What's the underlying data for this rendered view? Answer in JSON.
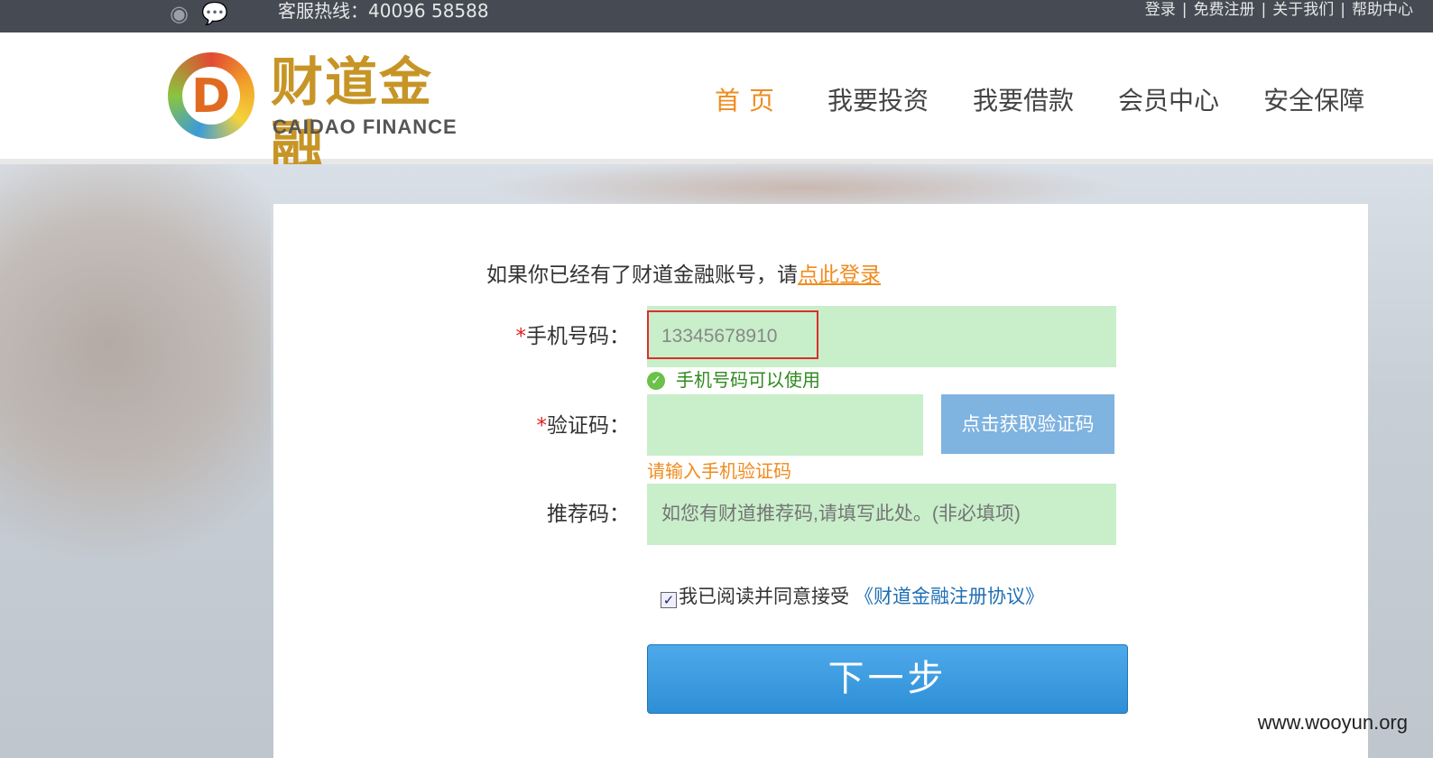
{
  "topbar": {
    "hotline": "客服热线：40096 58588",
    "links": [
      "登录",
      "免费注册",
      "关于我们",
      "帮助中心"
    ],
    "separator": "|"
  },
  "logo": {
    "cn": "财道金融",
    "en": "CAIDAO FINANCE",
    "mark": "D"
  },
  "nav": [
    "首页",
    "我要投资",
    "我要借款",
    "会员中心",
    "安全保障"
  ],
  "form": {
    "login_prompt": "如果你已经有了财道金融账号，请",
    "login_link": "点此登录",
    "phone_label": "手机号码：",
    "phone_value": "13345678910",
    "phone_ok": "手机号码可以使用",
    "code_label": "验证码：",
    "code_value": "",
    "get_code_button": "点击获取验证码",
    "code_error": "请输入手机验证码",
    "referral_label": "推荐码：",
    "referral_placeholder": "如您有财道推荐码,请填写此处。(非必填项)",
    "agree_text": "我已阅读并同意接受",
    "agree_link": "《财道金融注册协议》",
    "agree_checked": true,
    "next_button": "下一步",
    "required_mark": "*"
  },
  "watermark": "www.wooyun.org",
  "colors": {
    "accent": "#ef8b1d",
    "input_bg": "#c8eeca",
    "button": "#2e8fd6"
  }
}
